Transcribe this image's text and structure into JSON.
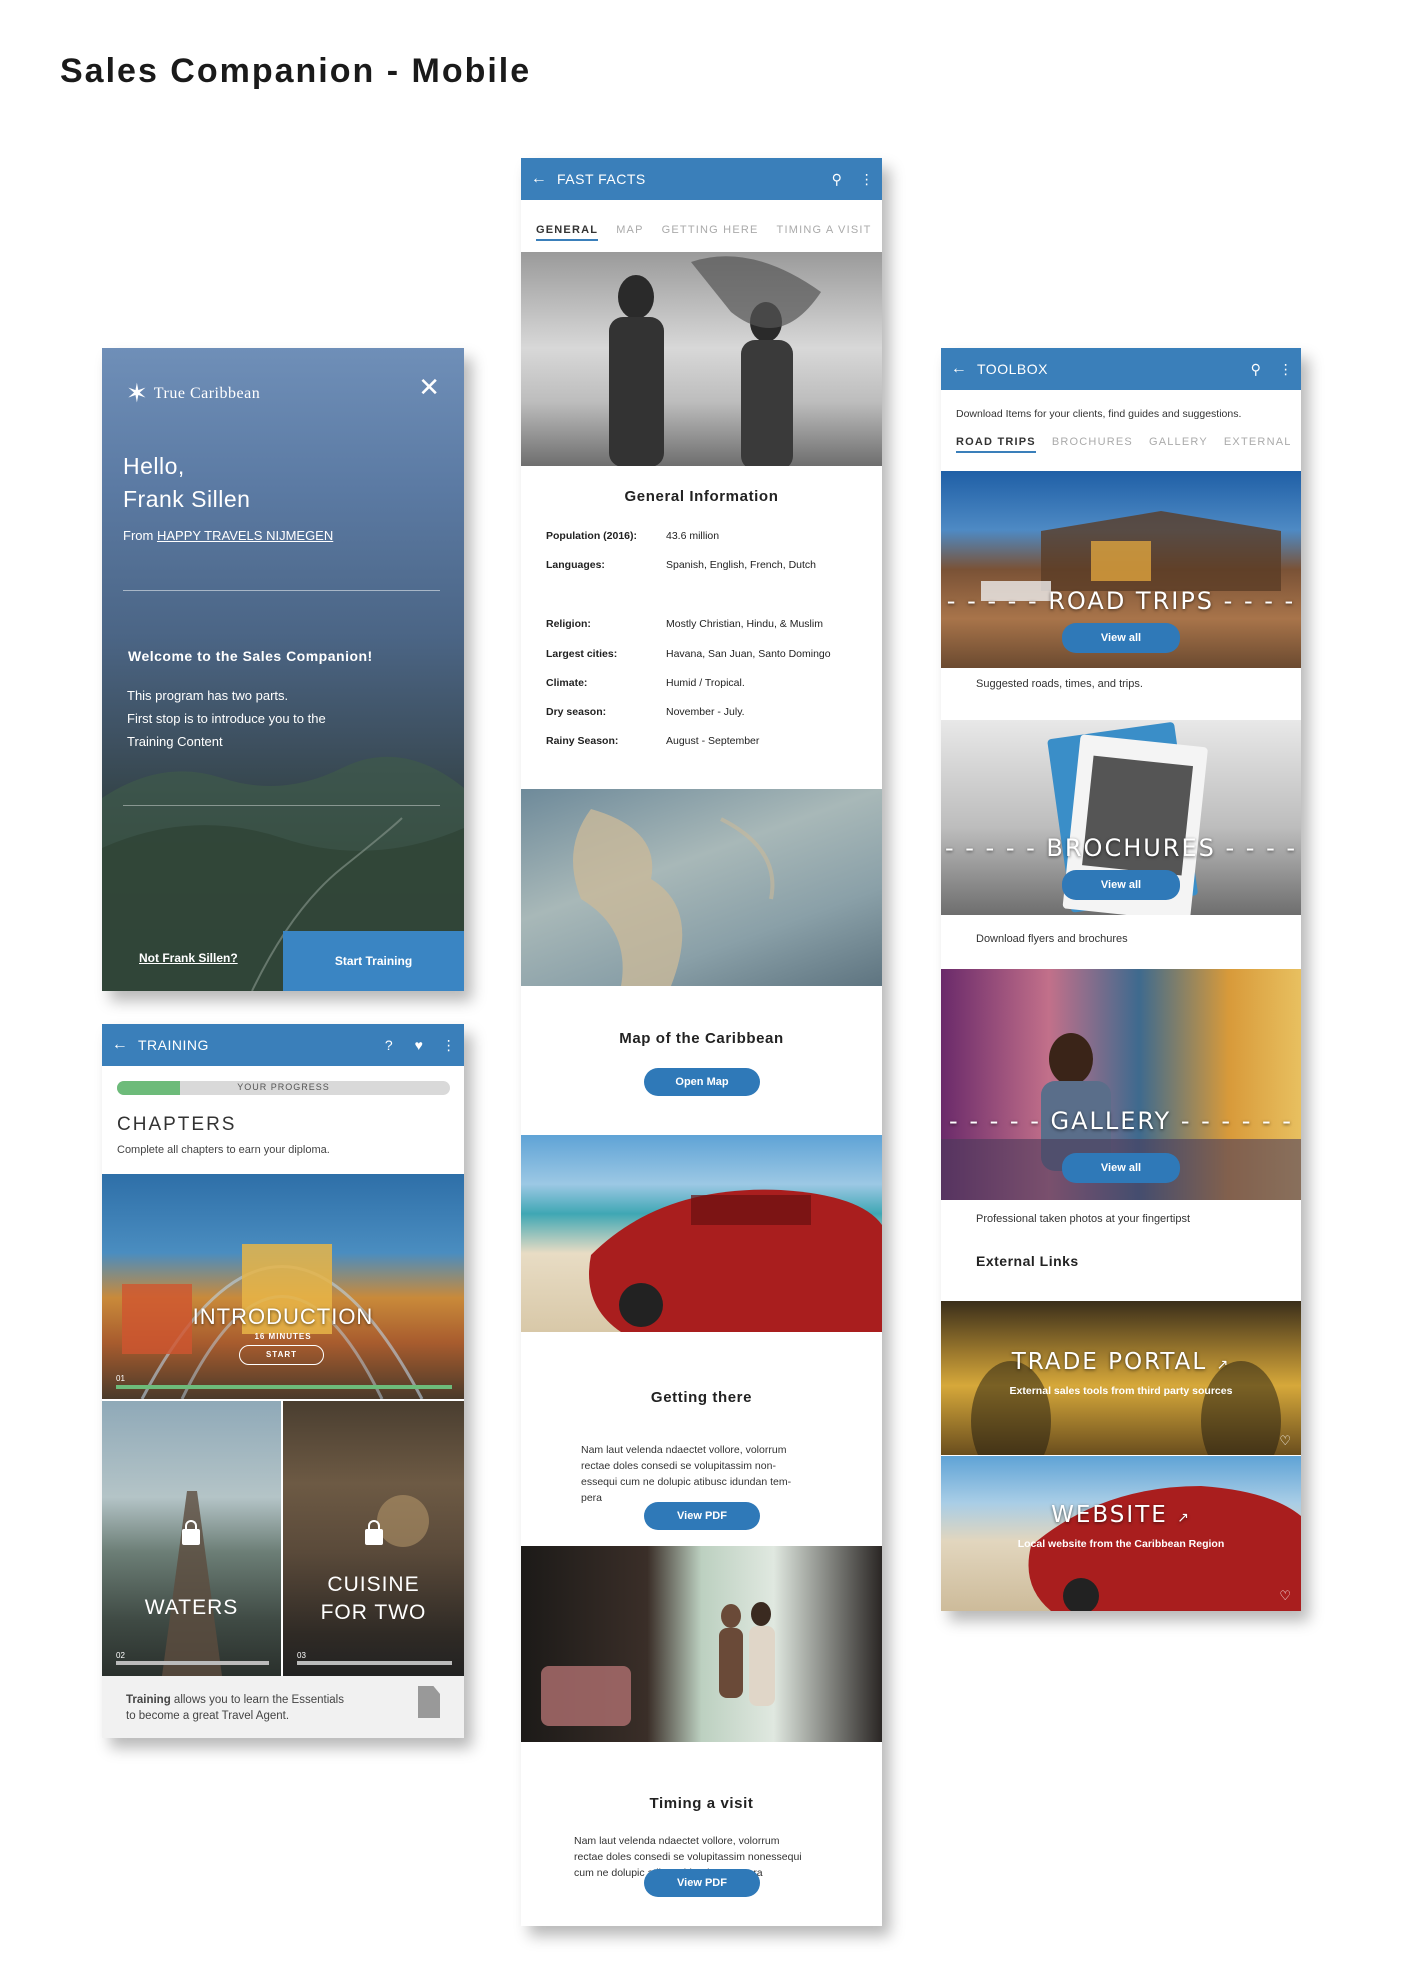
{
  "page_title": "Sales Companion - Mobile",
  "welcome": {
    "brand": "True Caribbean",
    "close_icon": "close-icon",
    "greeting_line1": "Hello,",
    "greeting_line2": "Frank Sillen",
    "from_prefix": "From",
    "agency": "HAPPY TRAVELS NIJMEGEN",
    "welcome_title": "Welcome to the Sales Companion!",
    "welcome_text_1": "This program has two parts.",
    "welcome_text_2": "First stop is to introduce you to the",
    "welcome_text_3": "Training Content",
    "not_user": "Not Frank Sillen?",
    "start_training": "Start Training"
  },
  "training": {
    "title": "TRAINING",
    "progress_label": "YOUR PROGRESS",
    "progress": 0.19,
    "chapters_title": "CHAPTERS",
    "chapters_sub": "Complete all chapters to earn your diploma.",
    "intro": {
      "title": "INTRODUCTION",
      "minutes": "16 MINUTES",
      "start": "START",
      "num": "01"
    },
    "waters": {
      "title": "WATERS",
      "num": "02"
    },
    "cuisine": {
      "title_1": "CUISINE",
      "title_2": "FOR TWO",
      "num": "03"
    },
    "footer_bold": "Training",
    "footer_text_1": " allows you to learn the Essentials",
    "footer_text_2": "to become a great Travel Agent."
  },
  "fastfacts": {
    "title": "FAST FACTS",
    "tabs": [
      "GENERAL",
      "MAP",
      "GETTING HERE",
      "TIMING A VISIT"
    ],
    "general_title": "General Information",
    "rows": [
      {
        "k": "Population (2016):",
        "v": "43.6 million"
      },
      {
        "k": "Languages:",
        "v": "Spanish, English, French, Dutch"
      },
      {
        "k": "Religion:",
        "v": "Mostly Christian, Hindu, & Muslim"
      },
      {
        "k": "Largest cities:",
        "v": "Havana, San Juan, Santo Domingo"
      },
      {
        "k": "Climate:",
        "v": "Humid / Tropical."
      },
      {
        "k": "Dry season:",
        "v": "November - July."
      },
      {
        "k": "Rainy Season:",
        "v": "August - September"
      }
    ],
    "map_title": "Map of the Caribbean",
    "open_map": "Open Map",
    "getting_title": "Getting there",
    "getting_text_1": "Nam laut velenda ndaectet vollore, volorrum",
    "getting_text_2": "rectae doles consedi se volupitassim non-",
    "getting_text_3": "essequi cum ne dolupic atibusc idundan tem-",
    "getting_text_4": "pera",
    "view_pdf_1": "View PDF",
    "timing_title": "Timing a visit",
    "timing_text_1": "Nam laut velenda ndaectet vollore, volorrum",
    "timing_text_2": "rectae doles consedi se volupitassim nonessequi",
    "timing_text_3": "cum ne dolupic atibusc idundan tempera",
    "view_pdf_2": "View PDF"
  },
  "toolbox": {
    "title": "TOOLBOX",
    "intro": "Download Items for your clients, find guides and suggestions.",
    "tabs": [
      "ROAD TRIPS",
      "BROCHURES",
      "GALLERY",
      "EXTERNAL"
    ],
    "road_trips": "ROAD TRIPS",
    "road_caption": "Suggested roads, times, and trips.",
    "brochures": "BROCHURES",
    "brochures_caption": "Download flyers and brochures",
    "gallery": "GALLERY",
    "gallery_caption": "Professional taken photos  at your fingertipst",
    "view_all": "View all",
    "external_title": "External Links",
    "trade_portal": "TRADE PORTAL",
    "trade_sub": "External sales tools from third party sources",
    "website": "WEBSITE",
    "website_sub": "Local website from the Caribbean Region"
  },
  "colors": {
    "accent": "#3a7fba",
    "progress": "#6dbb7a"
  }
}
